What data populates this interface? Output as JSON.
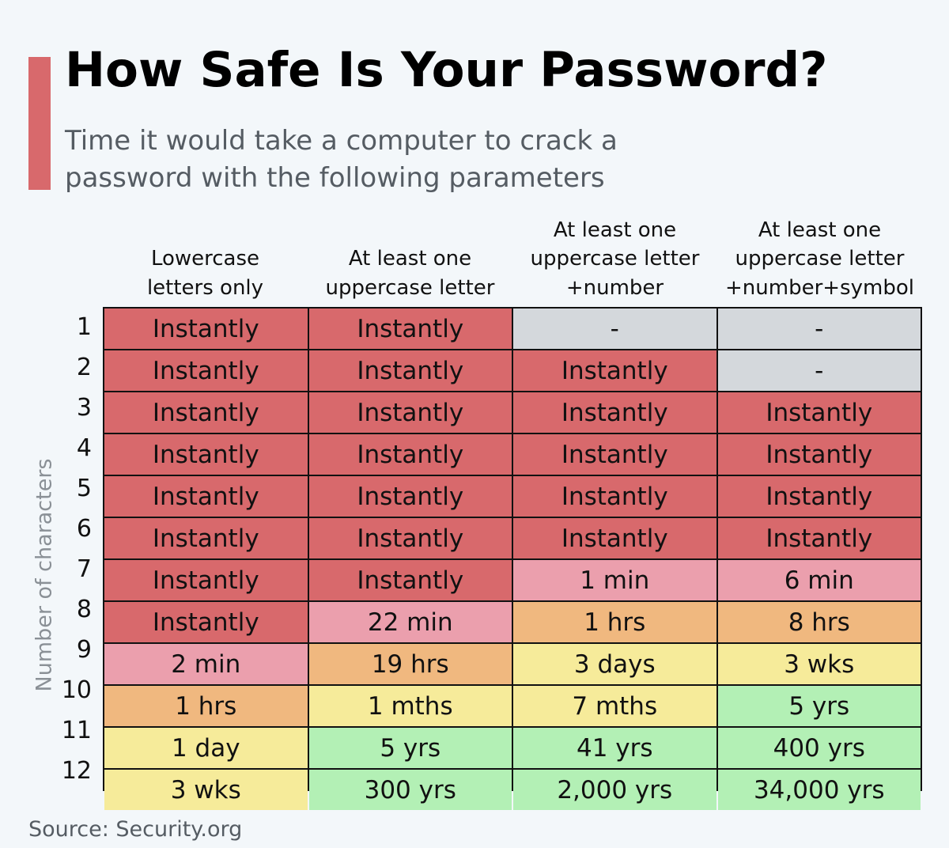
{
  "title": "How Safe Is Your Password?",
  "subtitle": "Time it would take a computer to crack a password with the following parameters",
  "source": "Source: Security.org",
  "colors": {
    "accent": "#d8696c",
    "instantly": "#d8696c",
    "minutes": "#eb9fad",
    "hours": "#f0b87f",
    "days_weeks_months": "#f6eb9a",
    "years": "#b3f0b5",
    "na": "#d4d8dc"
  },
  "chart_data": {
    "type": "table",
    "title": "How Safe Is Your Password?",
    "subtitle": "Time it would take a computer to crack a password with the following parameters",
    "ylabel": "Number of characters",
    "columns": [
      "Lowercase\nletters only",
      "At least one\nuppercase letter",
      "At least one\nuppercase letter\n+number",
      "At least one\nuppercase letter\n+number+symbol"
    ],
    "rows": [
      "1",
      "2",
      "3",
      "4",
      "5",
      "6",
      "7",
      "8",
      "9",
      "10",
      "11",
      "12"
    ],
    "values": [
      [
        "Instantly",
        "Instantly",
        "-",
        "-"
      ],
      [
        "Instantly",
        "Instantly",
        "Instantly",
        "-"
      ],
      [
        "Instantly",
        "Instantly",
        "Instantly",
        "Instantly"
      ],
      [
        "Instantly",
        "Instantly",
        "Instantly",
        "Instantly"
      ],
      [
        "Instantly",
        "Instantly",
        "Instantly",
        "Instantly"
      ],
      [
        "Instantly",
        "Instantly",
        "Instantly",
        "Instantly"
      ],
      [
        "Instantly",
        "Instantly",
        "1 min",
        "6 min"
      ],
      [
        "Instantly",
        "22 min",
        "1 hrs",
        "8 hrs"
      ],
      [
        "2 min",
        "19 hrs",
        "3 days",
        "3 wks"
      ],
      [
        "1 hrs",
        "1 mths",
        "7 mths",
        "5 yrs"
      ],
      [
        "1 day",
        "5 yrs",
        "41 yrs",
        "400 yrs"
      ],
      [
        "3 wks",
        "300 yrs",
        "2,000 yrs",
        "34,000 yrs"
      ]
    ]
  }
}
